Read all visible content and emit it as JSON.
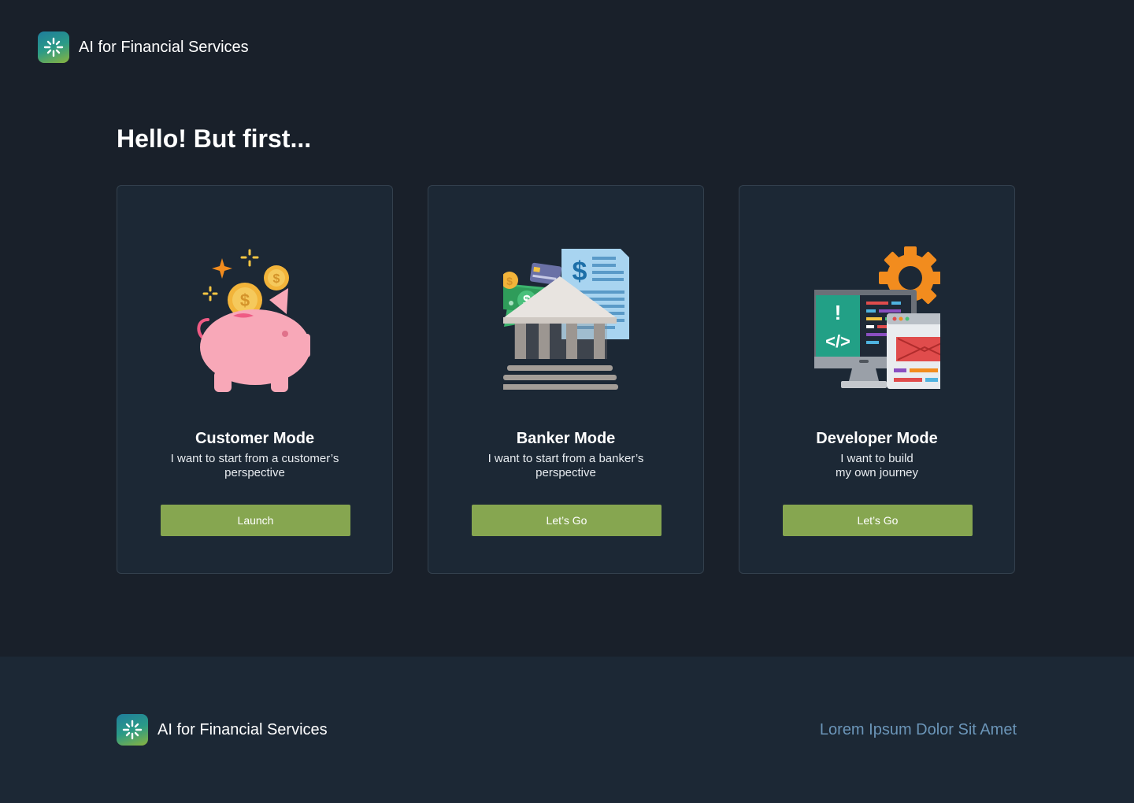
{
  "header": {
    "brand_title": "AI for Financial Services",
    "logo_icon": "sparkle-icon"
  },
  "main": {
    "heading": "Hello! But first...",
    "cards": [
      {
        "title": "Customer Mode",
        "desc_line1": "I want to start from a customer’s",
        "desc_line2": "perspective",
        "button": "Launch",
        "icon": "piggy-bank-icon"
      },
      {
        "title": "Banker Mode",
        "desc_line1": "I want to start from a banker’s",
        "desc_line2": "perspective",
        "button": "Let’s Go",
        "icon": "bank-building-icon"
      },
      {
        "title": "Developer Mode",
        "desc_line1": "I want to build",
        "desc_line2": "my own journey",
        "button": "Let’s Go",
        "icon": "developer-computer-icon"
      }
    ]
  },
  "footer": {
    "brand_title": "AI for Financial Services",
    "link": "Lorem Ipsum Dolor Sit Amet"
  },
  "colors": {
    "background": "#19202a",
    "card": "#1c2835",
    "button": "#86a650",
    "footer_link": "#6b95b8"
  }
}
